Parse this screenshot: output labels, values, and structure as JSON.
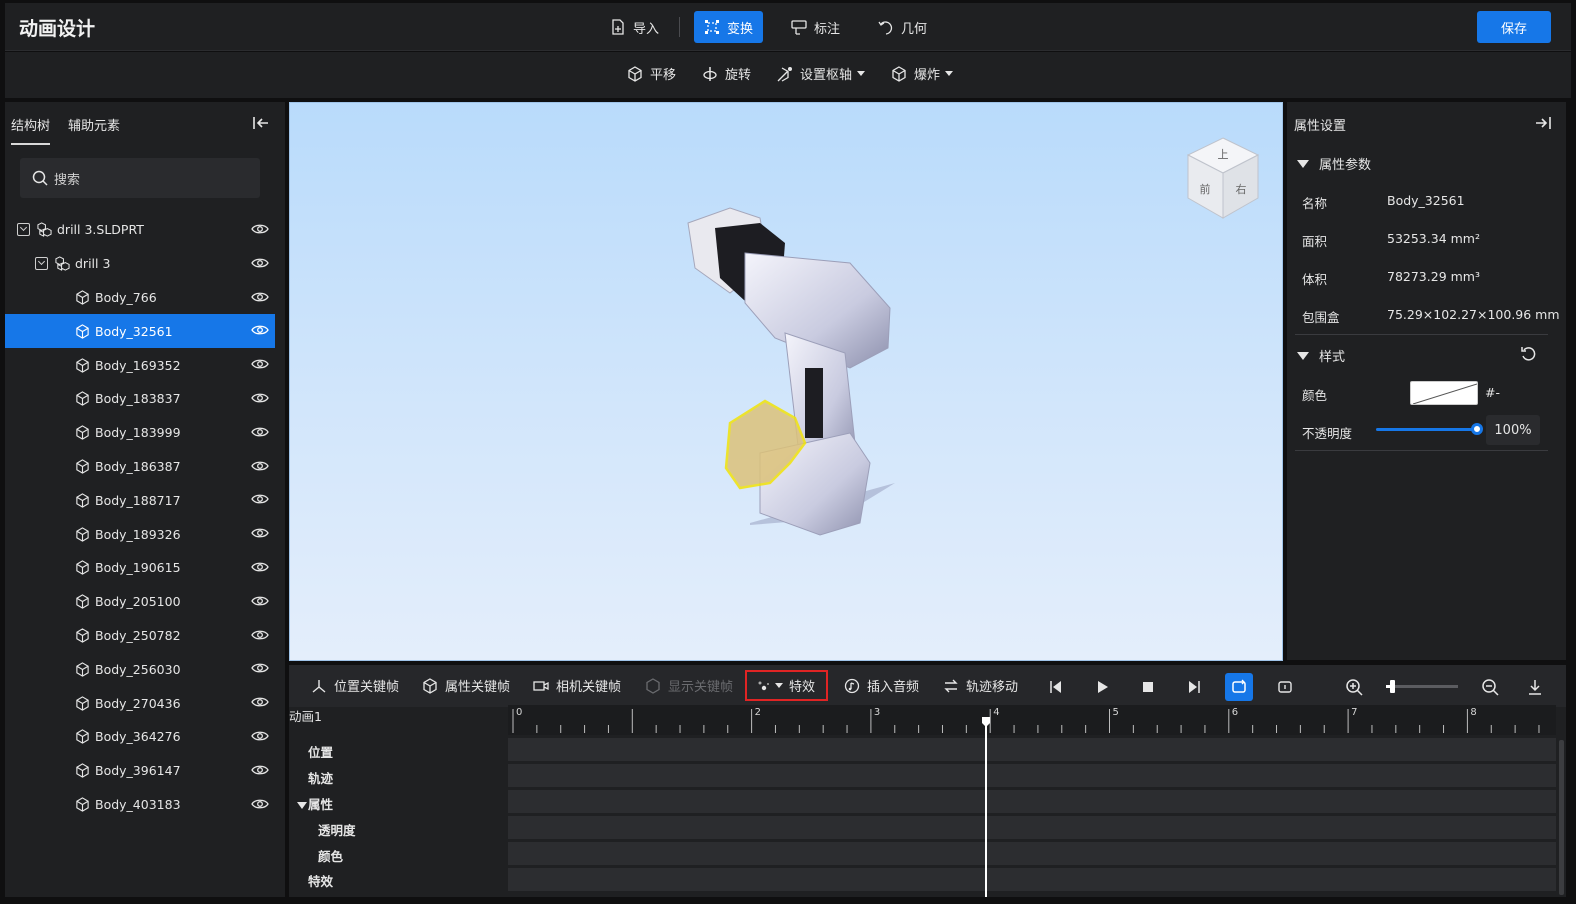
{
  "app": {
    "title": "动画设计",
    "save_label": "保存"
  },
  "top_tools": [
    {
      "label": "导入",
      "icon": "import-icon",
      "active": false
    },
    {
      "label": "变换",
      "icon": "transform-icon",
      "active": true
    },
    {
      "label": "标注",
      "icon": "annotation-icon",
      "active": false
    },
    {
      "label": "几何",
      "icon": "geometry-icon",
      "active": false
    }
  ],
  "sub_tools": [
    {
      "label": "平移",
      "icon": "move-icon",
      "dropdown": false
    },
    {
      "label": "旋转",
      "icon": "rotate-icon",
      "dropdown": false
    },
    {
      "label": "设置枢轴",
      "icon": "pivot-icon",
      "dropdown": true
    },
    {
      "label": "爆炸",
      "icon": "explode-icon",
      "dropdown": true
    }
  ],
  "left_panel": {
    "tabs": [
      "结构树",
      "辅助元素"
    ],
    "search_placeholder": "搜索",
    "tree": [
      {
        "label": "drill 3.SLDPRT",
        "level": 0,
        "type": "assembly",
        "selected": false
      },
      {
        "label": "drill 3",
        "level": 1,
        "type": "assembly",
        "selected": false
      },
      {
        "label": "Body_766",
        "level": 2,
        "type": "body",
        "selected": false
      },
      {
        "label": "Body_32561",
        "level": 2,
        "type": "body",
        "selected": true
      },
      {
        "label": "Body_169352",
        "level": 2,
        "type": "body",
        "selected": false
      },
      {
        "label": "Body_183837",
        "level": 2,
        "type": "body",
        "selected": false
      },
      {
        "label": "Body_183999",
        "level": 2,
        "type": "body",
        "selected": false
      },
      {
        "label": "Body_186387",
        "level": 2,
        "type": "body",
        "selected": false
      },
      {
        "label": "Body_188717",
        "level": 2,
        "type": "body",
        "selected": false
      },
      {
        "label": "Body_189326",
        "level": 2,
        "type": "body",
        "selected": false
      },
      {
        "label": "Body_190615",
        "level": 2,
        "type": "body",
        "selected": false
      },
      {
        "label": "Body_205100",
        "level": 2,
        "type": "body",
        "selected": false
      },
      {
        "label": "Body_250782",
        "level": 2,
        "type": "body",
        "selected": false
      },
      {
        "label": "Body_256030",
        "level": 2,
        "type": "body",
        "selected": false
      },
      {
        "label": "Body_270436",
        "level": 2,
        "type": "body",
        "selected": false
      },
      {
        "label": "Body_364276",
        "level": 2,
        "type": "body",
        "selected": false
      },
      {
        "label": "Body_396147",
        "level": 2,
        "type": "body",
        "selected": false
      },
      {
        "label": "Body_403183",
        "level": 2,
        "type": "body",
        "selected": false
      }
    ]
  },
  "view_cube": {
    "top": "上",
    "front": "前",
    "right": "右"
  },
  "right_panel": {
    "title": "属性设置",
    "attr_section": "属性参数",
    "props": [
      {
        "label": "名称",
        "value": "Body_32561"
      },
      {
        "label": "面积",
        "value": "53253.34 mm²"
      },
      {
        "label": "体积",
        "value": "78273.29 mm³"
      },
      {
        "label": "包围盒",
        "value": "75.29×102.27×100.96 mm"
      }
    ],
    "style_section": "样式",
    "color_label": "颜色",
    "color_value": "#-",
    "opacity_label": "不透明度",
    "opacity_value": "100%",
    "opacity_fraction": 1.0
  },
  "timeline": {
    "toolbar": {
      "position_keyframe": "位置关键帧",
      "property_keyframe": "属性关键帧",
      "camera_keyframe": "相机关键帧",
      "show_keyframe": "显示关键帧",
      "effects": "特效",
      "insert_audio": "插入音频",
      "path_move": "轨迹移动"
    },
    "animation_name": "动画1",
    "tracks": [
      "位置",
      "轨迹",
      "属性",
      "透明度",
      "颜色",
      "特效"
    ],
    "ruler_labels": [
      "0",
      "2",
      "3",
      "4",
      "5",
      "6",
      "7",
      "8"
    ],
    "playhead_seconds": 3.8
  },
  "colors": {
    "accent": "#1677e8",
    "highlight": "#e02424",
    "selection_yellow": "#f1e30a"
  }
}
